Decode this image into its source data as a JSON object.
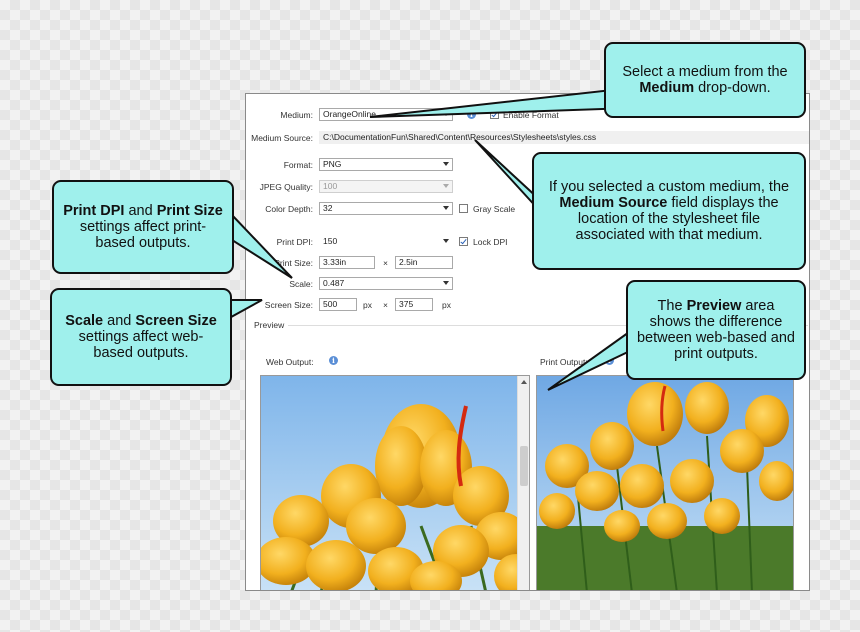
{
  "form": {
    "medium_label": "Medium:",
    "medium_value": "OrangeOnline",
    "enable_format_label": "Enable Format",
    "medium_source_label": "Medium Source:",
    "medium_source_value": "C:\\DocumentationFun\\Shared\\Content\\Resources\\Stylesheets\\styles.css",
    "format_label": "Format:",
    "format_value": "PNG",
    "jpeg_quality_label": "JPEG Quality:",
    "jpeg_quality_value": "100",
    "color_depth_label": "Color Depth:",
    "color_depth_value": "32",
    "gray_scale_label": "Gray Scale",
    "print_dpi_label": "Print DPI:",
    "print_dpi_value": "150",
    "lock_dpi_label": "Lock DPI",
    "print_size_label": "Print Size:",
    "print_size_width": "3.33in",
    "print_size_x": "×",
    "print_size_height": "2.5in",
    "scale_label": "Scale:",
    "scale_value": "0.487",
    "screen_size_label": "Screen Size:",
    "screen_size_width": "500",
    "screen_size_width_unit": "px",
    "screen_size_x": "×",
    "screen_size_height": "375",
    "screen_size_height_unit": "px"
  },
  "preview": {
    "section_label": "Preview",
    "web_output_label": "Web Output:",
    "print_output_label": "Print Output:"
  },
  "callouts": {
    "medium": {
      "t1": "Select a medium from the ",
      "b1": "Medium",
      "t2": " drop-down."
    },
    "source": {
      "t1": "If you selected a custom medium, the ",
      "b1": "Medium Source",
      "t2": " field displays the location of the stylesheet file associated with that medium."
    },
    "dpi": {
      "b1": "Print DPI",
      "t1": " and ",
      "b2": "Print Size",
      "t2": " settings affect print-based outputs."
    },
    "scale": {
      "b1": "Scale",
      "t1": " and ",
      "b2": "Screen Size",
      "t2": " settings affect web-based outputs."
    },
    "preview": {
      "t1": "The ",
      "b1": "Preview",
      "t2": " area shows the difference between web-based and print outputs."
    }
  },
  "icons": [
    "info-icon",
    "dropdown-arrow-icon",
    "checkbox-icon",
    "scroll-up-icon",
    "scroll-down-icon"
  ],
  "colors": {
    "callout_fill": "#9ff0ec",
    "sky": "#8ec3ef",
    "tulip": "#f2b01e"
  }
}
